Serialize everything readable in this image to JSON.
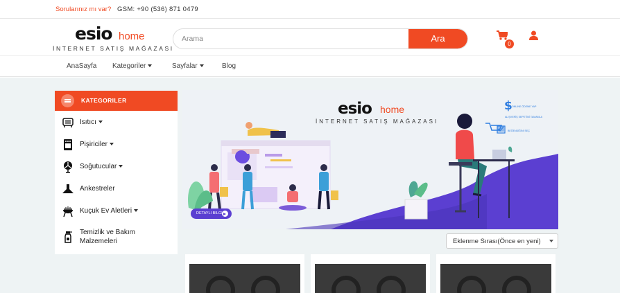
{
  "topbar": {
    "question": "Sorularınız mı var?",
    "phone": "GSM: +90 (536) 871 0479"
  },
  "logo": {
    "brand": "esio",
    "home": "home",
    "tagline": "İNTERNET SATIŞ MAĞAZASI"
  },
  "search": {
    "placeholder": "Arama",
    "button": "Ara"
  },
  "cart": {
    "count": "0"
  },
  "nav": [
    {
      "label": "AnaSayfa"
    },
    {
      "label": "Kategoriler"
    },
    {
      "label": "Sayfalar"
    },
    {
      "label": "Blog"
    }
  ],
  "sidebar": {
    "title": "KATEGORILER",
    "items": [
      {
        "label": "Isıtıcı",
        "icon": "heater-icon"
      },
      {
        "label": "Pişiriciler",
        "icon": "oven-icon"
      },
      {
        "label": "Soğutucular",
        "icon": "fan-icon"
      },
      {
        "label": "Ankestreler",
        "icon": "hood-icon"
      },
      {
        "label": "Kuçuk Ev Aletleri",
        "icon": "grill-icon"
      },
      {
        "label": "Temizlik ve Bakım Malzemeleri",
        "icon": "spray-bottle-icon"
      }
    ]
  },
  "banner": {
    "brand": "esio",
    "home": "home",
    "tagline": "İNTERNET SATIŞ MAĞAZASI",
    "button": "DETAYLI BILGI?",
    "steps": [
      "ONLİNE ÖDEME YAP",
      "ALIŞVERİŞ SEPETİNİ TAMAMLA",
      "BEĞENDİĞİNİ SEÇ"
    ]
  },
  "sort": {
    "selected": "Eklenme Sırası(Önce en yeni)"
  },
  "colors": {
    "accent": "#f04a23",
    "purple": "#5b3fd1",
    "page_bg": "#eef3f4"
  }
}
